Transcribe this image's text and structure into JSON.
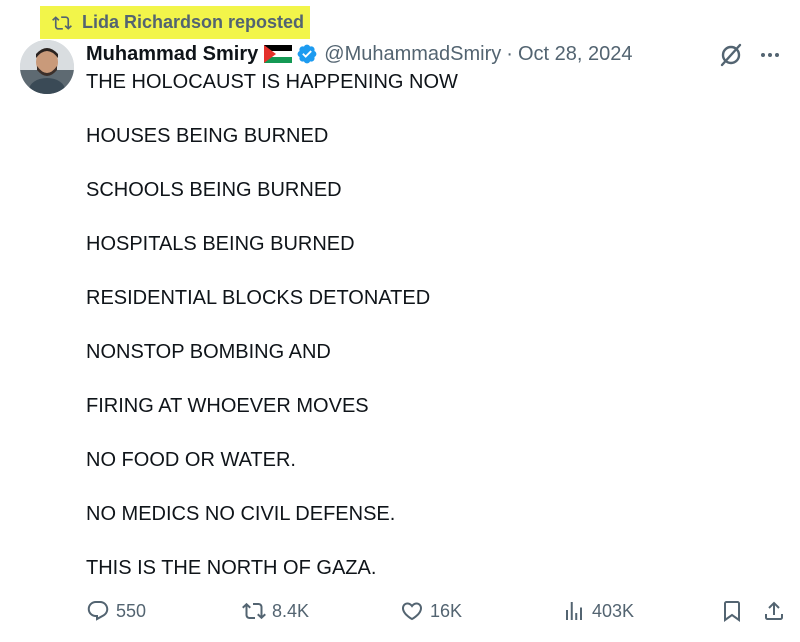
{
  "repost": {
    "label": "Lida Richardson reposted",
    "highlight_color": "#f2f54a"
  },
  "author": {
    "name": "Muhammad Smiry",
    "handle": "@MuhammadSmiry",
    "separator": "·",
    "date": "Oct 28, 2024",
    "verified_color": "#1d9bf0"
  },
  "post": {
    "lines": [
      "THE HOLOCAUST IS HAPPENING NOW",
      "HOUSES BEING BURNED",
      "SCHOOLS BEING BURNED",
      "HOSPITALS BEING BURNED",
      "RESIDENTIAL BLOCKS DETONATED",
      "NONSTOP BOMBING AND",
      "FIRING AT WHOEVER MOVES",
      "NO FOOD OR WATER.",
      "NO MEDICS NO CIVIL DEFENSE.",
      "THIS IS THE NORTH OF GAZA."
    ]
  },
  "actions": {
    "replies": "550",
    "reposts": "8.4K",
    "likes": "16K",
    "views": "403K"
  },
  "icons": [
    "repost-icon",
    "verified-icon",
    "grok-icon",
    "more-icon",
    "reply-icon",
    "like-icon",
    "views-icon",
    "bookmark-icon",
    "share-icon"
  ]
}
